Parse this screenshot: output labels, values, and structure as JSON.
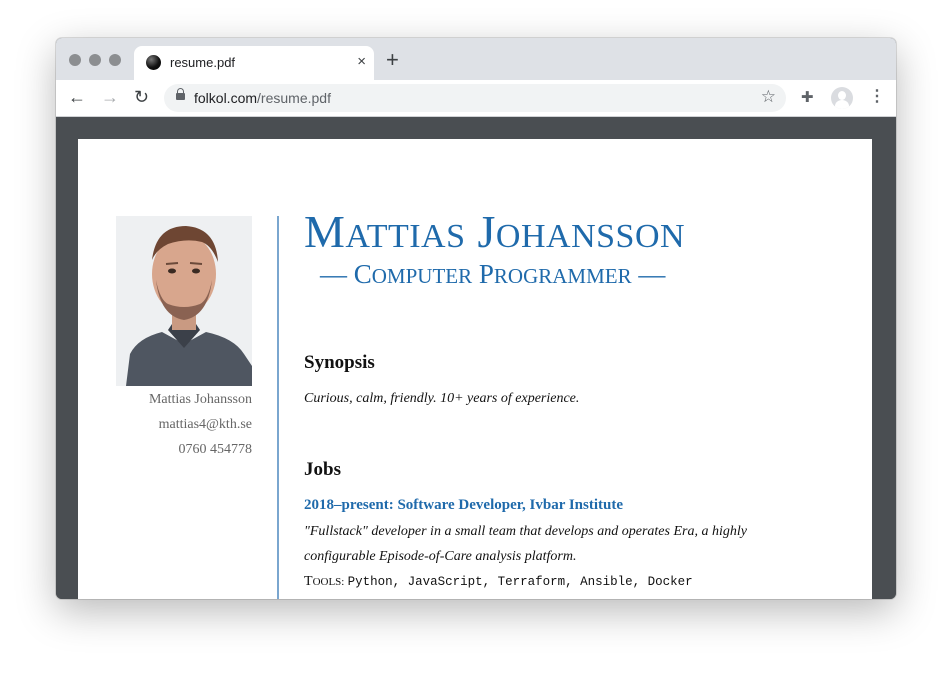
{
  "browser": {
    "tab": {
      "title": "resume.pdf",
      "close_glyph": "×"
    },
    "new_tab_glyph": "+",
    "nav": {
      "back_glyph": "←",
      "forward_glyph": "→",
      "reload_glyph": "↻"
    },
    "address": {
      "host": "folkol.com",
      "path": "/resume.pdf"
    },
    "bookmark_glyph": "☆",
    "extensions_glyph": "✚",
    "menu_glyph": "⋮",
    "icons": [
      "favicon-icon",
      "lock-icon",
      "star-icon",
      "puzzle-icon",
      "profile-icon",
      "kebab-menu-icon"
    ]
  },
  "resume": {
    "name_first_initial": "M",
    "name_first_rest": "ATTIAS",
    "name_last_initial": "J",
    "name_last_rest": "OHANSSON",
    "subtitle_dash_left": "— ",
    "subtitle_w1_initial": "C",
    "subtitle_w1_rest": "OMPUTER",
    "subtitle_w2_initial": "P",
    "subtitle_w2_rest": "ROGRAMMER",
    "subtitle_dash_right": " —",
    "sidebar": {
      "name": "Mattias Johansson",
      "email": "mattias4@kth.se",
      "phone": "0760 454778"
    },
    "synopsis": {
      "heading": "Synopsis",
      "text": "Curious, calm, friendly. 10+ years of experience."
    },
    "jobs": {
      "heading": "Jobs",
      "items": [
        {
          "title": "2018–present: Software Developer, Ivbar Institute",
          "desc_line1": "\"Fullstack\" developer in a small team that develops and operates Era, a highly",
          "desc_line2": "configurable Episode-of-Care analysis platform.",
          "tools_label_initial": "T",
          "tools_label_rest": "OOLS:",
          "tools": "Python, JavaScript, Terraform, Ansible, Docker"
        }
      ]
    }
  },
  "colors": {
    "accent": "#1f6aab",
    "viewer_bg": "#4a4e52",
    "tabstrip": "#dee1e6"
  }
}
